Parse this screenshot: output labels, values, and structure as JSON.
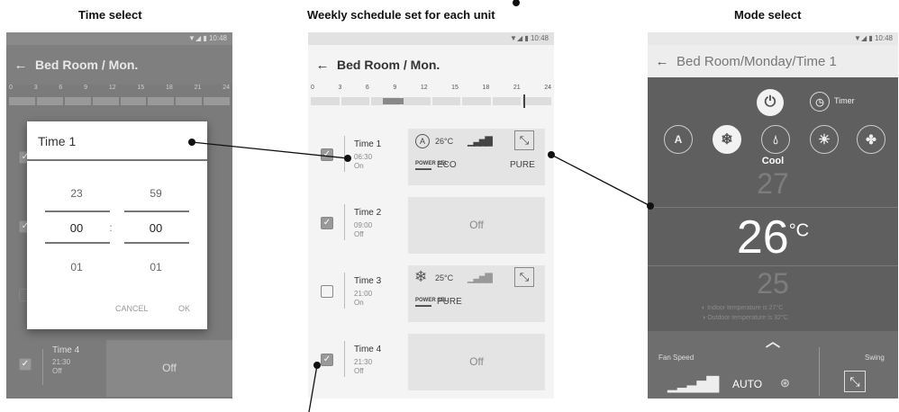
{
  "captions": {
    "left": "Time select",
    "middle": "Weekly schedule set for each unit",
    "right": "Mode select"
  },
  "status_time": "10:48",
  "title": "Bed Room / Mon.",
  "hours": [
    "0",
    "3",
    "6",
    "9",
    "12",
    "15",
    "18",
    "21",
    "24"
  ],
  "left_hours": [
    "0",
    "3",
    "6",
    "9",
    "12",
    "15",
    "18",
    "21",
    "24"
  ],
  "dialog": {
    "title": "Time 1",
    "hour_prev": "23",
    "hour": "00",
    "hour_next": "01",
    "minute_prev": "59",
    "minute": "00",
    "minute_next": "01",
    "separator": ":",
    "cancel": "CANCEL",
    "ok": "OK"
  },
  "left_bottom": {
    "name": "Time 4",
    "time": "21:30",
    "state": "Off",
    "card": "Off"
  },
  "rows": [
    {
      "name": "Time 1",
      "time": "06:30",
      "state": "On",
      "checked": true,
      "card": {
        "temp": "26°C",
        "badge": "ECO",
        "purify": "PURE",
        "mode_icon": "auto-mode-icon"
      }
    },
    {
      "name": "Time 2",
      "time": "09:00",
      "state": "Off",
      "checked": true,
      "card": {
        "off": "Off"
      }
    },
    {
      "name": "Time 3",
      "time": "21:00",
      "state": "On",
      "checked": false,
      "card": {
        "temp": "25°C",
        "purify": "PURE",
        "mode_icon": "snowflake-icon"
      }
    },
    {
      "name": "Time 4",
      "time": "21:30",
      "state": "Off",
      "checked": true,
      "card": {
        "off": "Off"
      }
    }
  ],
  "mode": {
    "title": "Bed Room/Monday/Time 1",
    "timer": "Timer",
    "selected": "Cool",
    "temp_above": "27",
    "temp": "26",
    "unit": "°C",
    "temp_below": "25",
    "indoor": "Indoor temperature is  27°C",
    "outdoor": "Outdoor temperature is  32°C",
    "fan_label": "Fan Speed",
    "fan_value": "AUTO",
    "swing_label": "Swing"
  },
  "colors": {
    "accent": "#ffffff",
    "panel_bg": "#5f5f5f"
  }
}
